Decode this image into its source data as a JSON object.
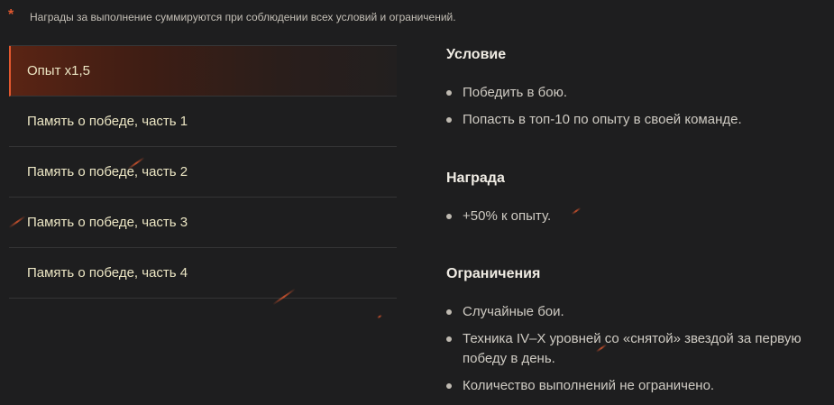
{
  "note": {
    "marker": "*",
    "text": "Награды за выполнение суммируются при соблюдении всех условий и ограничений."
  },
  "quests": [
    {
      "label": "Опыт x1,5",
      "active": true
    },
    {
      "label": "Память о победе, часть 1",
      "active": false
    },
    {
      "label": "Память о победе, часть 2",
      "active": false
    },
    {
      "label": "Память о победе, часть 3",
      "active": false
    },
    {
      "label": "Память о победе, часть 4",
      "active": false
    }
  ],
  "details": {
    "condition": {
      "title": "Условие",
      "items": [
        "Победить в бою.",
        "Попасть в топ-10 по опыту в своей команде."
      ]
    },
    "reward": {
      "title": "Награда",
      "items": [
        "+50% к опыту."
      ]
    },
    "limits": {
      "title": "Ограничения",
      "items": [
        "Случайные бои.",
        "Техника IV–X уровней со «снятой» звездой за первую победу в день.",
        "Количество выполнений не ограничено."
      ]
    }
  },
  "colors": {
    "accent": "#e2582e",
    "background": "#1e1e1f",
    "quest_text": "#ece6c4"
  }
}
